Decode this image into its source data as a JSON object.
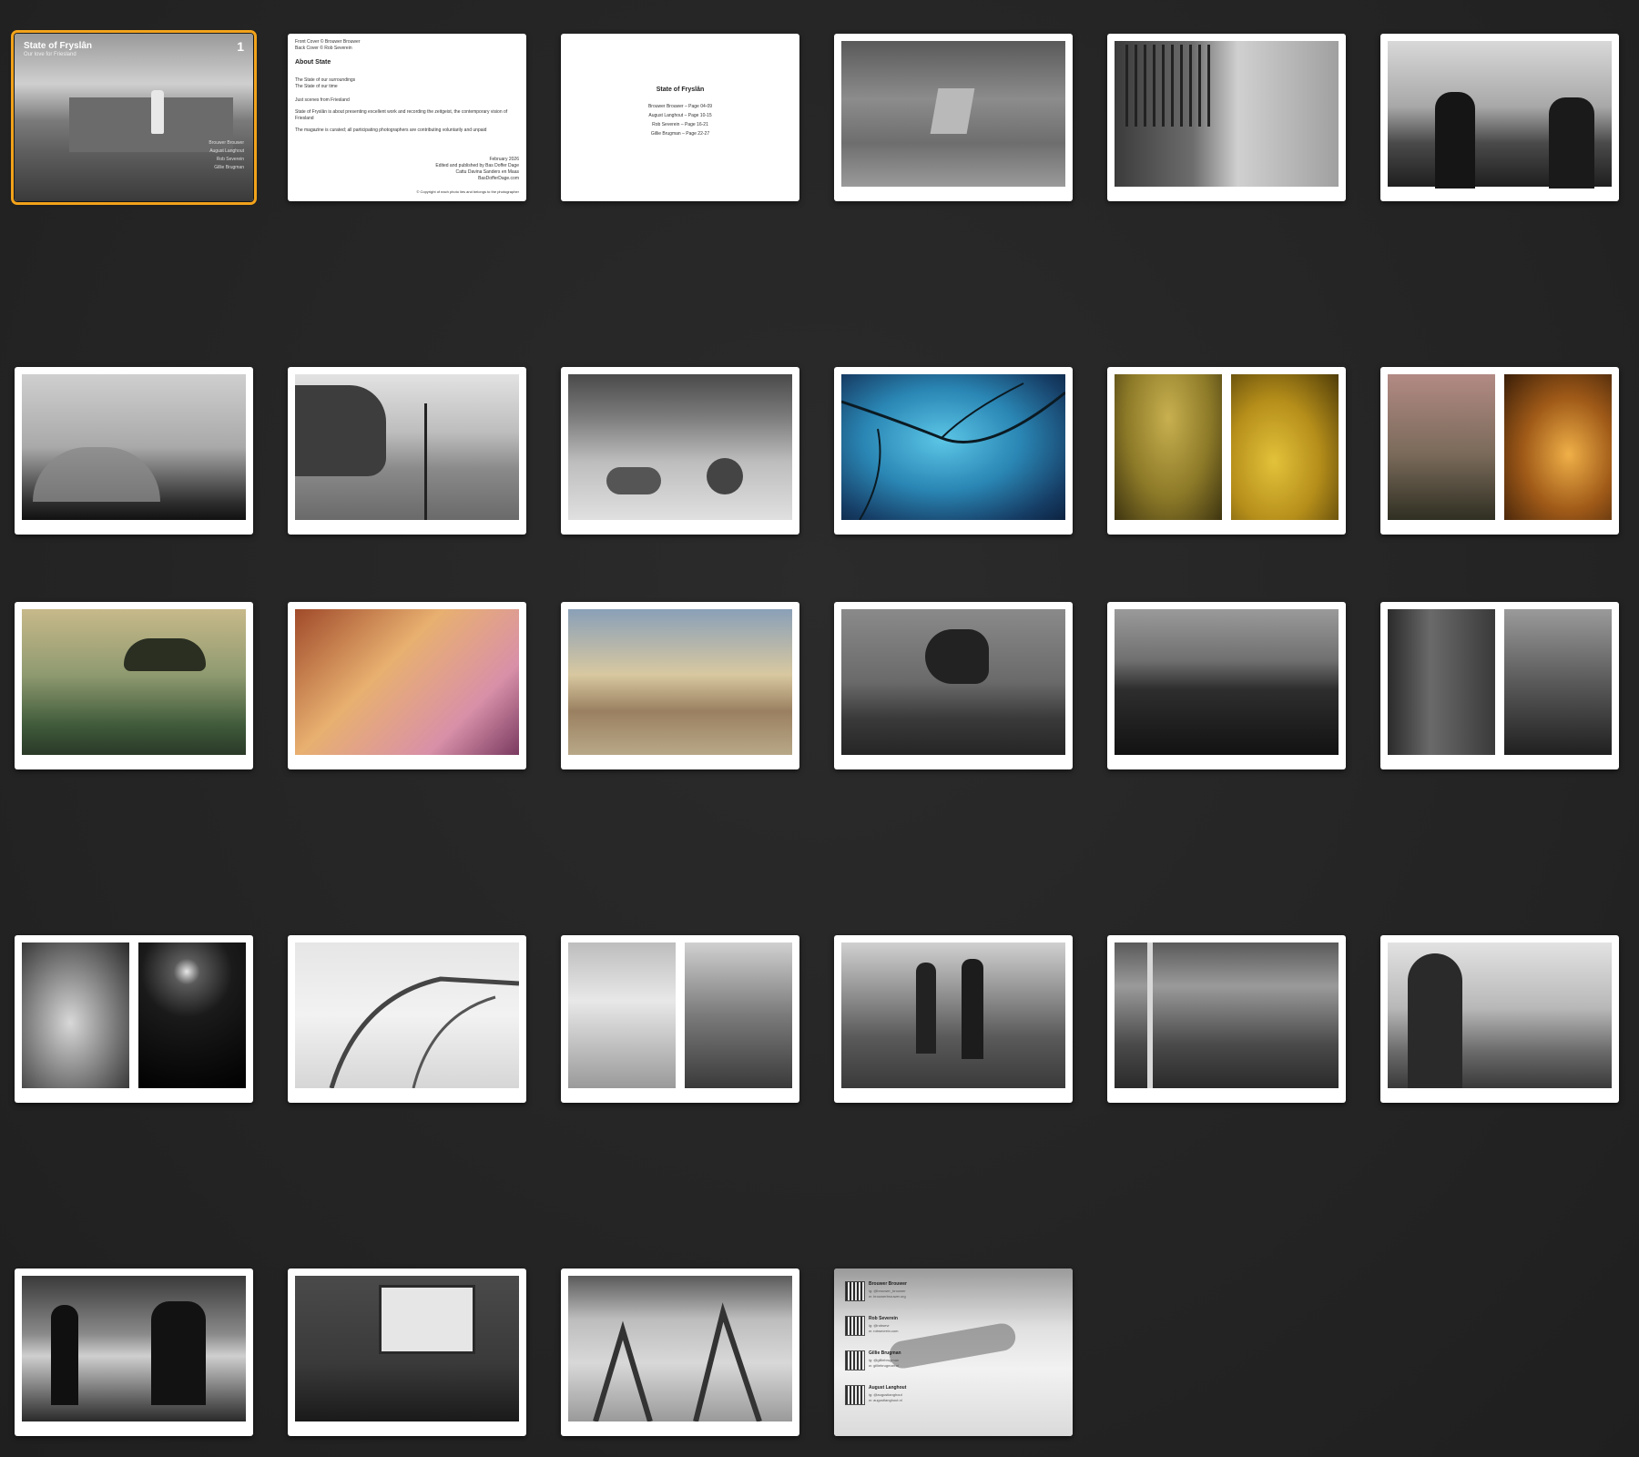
{
  "cover": {
    "title": "State of Fryslân",
    "subtitle": "Our love for Friesland",
    "number": "1",
    "names": [
      "Brouwer Brouwer",
      "August Langhout",
      "Rob Severein",
      "Gillie Brugman"
    ]
  },
  "about_page": {
    "credits": [
      "Front Cover © Brouwer Brouwer",
      "Back Cover © Rob Severein"
    ],
    "heading": "About State",
    "lines": [
      "The State of our surroundings",
      "The State of our time",
      "Just scenes from Friesland",
      "State of Fryslân is about presenting excellent work and recording the zeitgeist, the contemporary vision of Friesland",
      "The magazine is curated; all participating photographers are contributing voluntarily and unpaid"
    ],
    "footer": [
      "February 2026",
      "Edited and published by Bas Doffer Dage",
      "Cattu Davina Sanders en Maas",
      "BasDofferDage.com"
    ],
    "copyright": "© Copyright of each photo lies and belongs to the photographer"
  },
  "contents_page": {
    "heading": "State of Fryslân",
    "entries": [
      "Brouwer Brouwer – Page 04-09",
      "August Langhout – Page 10-15",
      "Rob Severein – Page 16-21",
      "Gillie Brugman – Page 22-27"
    ]
  },
  "back_cover": {
    "contacts": [
      {
        "name": "Brouwer Brouwer",
        "lines": [
          "ig: @brouwer_brouwer",
          "w: brouwerbrouwer.org"
        ]
      },
      {
        "name": "Rob Severein",
        "lines": [
          "ig: @robsevr",
          "w: robsevrein.com"
        ]
      },
      {
        "name": "Gillie Brugman",
        "lines": [
          "ig: @gilliebrugman",
          "w: gilliebrugman.nl"
        ]
      },
      {
        "name": "August Langhout",
        "lines": [
          "ig: @augustlanghout",
          "w: augustlanghout.nl"
        ]
      }
    ]
  },
  "colors": {
    "background": "#262626",
    "selection": "#f2a31b"
  }
}
